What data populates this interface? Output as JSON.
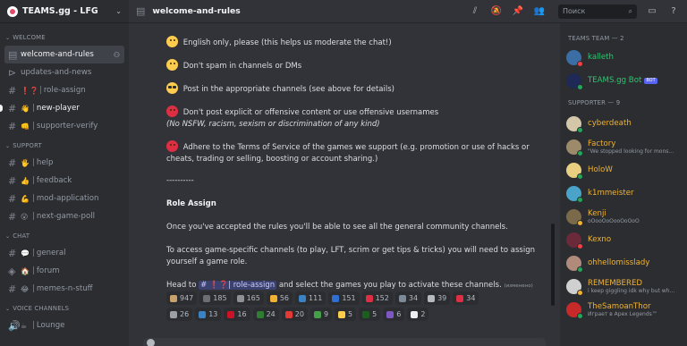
{
  "server": {
    "name": "TEAMS.gg - LFG"
  },
  "sidebar": {
    "cat_welcome": "WELCOME",
    "welcome_channels": [
      {
        "label": "welcome-and-rules"
      },
      {
        "label": "updates-and-news"
      },
      {
        "label": "role-assign",
        "emoji": "❗❓"
      },
      {
        "label": "new-player",
        "emoji": "👋"
      },
      {
        "label": "supporter-verify",
        "emoji": "👊"
      }
    ],
    "cat_support": "SUPPORT",
    "support_channels": [
      {
        "label": "help",
        "emoji": "🖐"
      },
      {
        "label": "feedback",
        "emoji": "👍"
      },
      {
        "label": "mod-application",
        "emoji": "💪"
      },
      {
        "label": "next-game-poll",
        "emoji": "😮"
      }
    ],
    "cat_chat": "CHAT",
    "chat_channels": [
      {
        "label": "general",
        "emoji": "💬"
      },
      {
        "label": "forum",
        "emoji": "🏠"
      },
      {
        "label": "memes-n-stuff"
      }
    ],
    "cat_voice": "VOICE CHANNELS",
    "voice_channels": [
      {
        "label": "Lounge",
        "emoji": "☕"
      }
    ]
  },
  "topbar": {
    "channel": "welcome-and-rules",
    "search_placeholder": "Поиск"
  },
  "messages": {
    "rule1": "English only, please (this helps us moderate the chat!)",
    "rule2": "Don't spam in channels or DMs",
    "rule3": "Post in the appropriate channels (see above for details)",
    "rule4": "Don't post explicit or offensive content or use offensive usernames",
    "rule4_note": "(No NSFW, racism, sexism or discrimination of any kind)",
    "rule5a": "Adhere to the Terms of Service of the games we support (e.g. promotion or use of hacks or",
    "rule5b": "cheats, trading or selling, boosting or account sharing.)",
    "divider": "----------",
    "role_heading": "Role Assign",
    "para1": "Once you've accepted the rules you'll be able to see all the general community channels.",
    "para2a": "To access game-specific channels (to play, LFT, scrim or get tips & tricks) you will need to assign",
    "para2b": "yourself a game role.",
    "head_to": "Head to",
    "mention": "# ❗❓| role-assign",
    "head_to_rest": "and select the games you play to activate these channels.",
    "edited": "(изменено)"
  },
  "reactions": {
    "row1": [
      {
        "count": "947",
        "color": "#c8a26b"
      },
      {
        "count": "185",
        "color": "#6b6e73"
      },
      {
        "count": "165",
        "color": "#8e9297"
      },
      {
        "count": "56",
        "color": "#f0b232"
      },
      {
        "count": "111",
        "color": "#3b82c4"
      },
      {
        "count": "151",
        "color": "#2f6fd1"
      },
      {
        "count": "152",
        "color": "#dd2e44"
      },
      {
        "count": "34",
        "color": "#7c8a9a"
      },
      {
        "count": "39",
        "color": "#b5bac1"
      },
      {
        "count": "34",
        "color": "#dd2e44"
      }
    ],
    "row2": [
      {
        "count": "26",
        "color": "#9aa0a6"
      },
      {
        "count": "13",
        "color": "#3b82c4"
      },
      {
        "count": "16",
        "color": "#ce1126"
      },
      {
        "count": "24",
        "color": "#2e7d32"
      },
      {
        "count": "20",
        "color": "#e53935"
      },
      {
        "count": "9",
        "color": "#43a047"
      },
      {
        "count": "5",
        "color": "#ffcc4d"
      },
      {
        "count": "5",
        "color": "#1b5e20"
      },
      {
        "count": "6",
        "color": "#7e57c2"
      },
      {
        "count": "2",
        "color": "#eceff1"
      }
    ]
  },
  "members": {
    "team_header": "TEAMS TEAM — 2",
    "team": [
      {
        "name": "kalleth",
        "color": "#2dc770",
        "avatar": "#3a6ea5",
        "status": "dnd"
      },
      {
        "name": "TEAMS.gg Bot",
        "color": "#2dc770",
        "avatar": "#1e2a55",
        "status": "online",
        "tag": "BOT"
      }
    ],
    "supporter_header": "SUPPORTER — 9",
    "supporters": [
      {
        "name": "cyberdeath",
        "color": "#f0b232",
        "avatar": "#d4c6a8",
        "status": "online"
      },
      {
        "name": "Factory",
        "color": "#f0b232",
        "avatar": "#9c8a6a",
        "status": "online",
        "sub": "\"We stopped looking for mons..."
      },
      {
        "name": "HoloW",
        "color": "#f0b232",
        "avatar": "#e8d080",
        "status": "online"
      },
      {
        "name": "k1mmeister",
        "color": "#f0b232",
        "avatar": "#4aa3c8",
        "status": "online"
      },
      {
        "name": "Kenji",
        "color": "#f0b232",
        "avatar": "#7a6a4a",
        "status": "idle",
        "sub": "oOooOoOooOoOoO"
      },
      {
        "name": "Kexno",
        "color": "#f0b232",
        "avatar": "#6a2a3a",
        "status": "dnd"
      },
      {
        "name": "ohhellomisslady",
        "color": "#f0b232",
        "avatar": "#b08a7a",
        "status": "online"
      },
      {
        "name": "REMEMBERED",
        "color": "#f0b232",
        "avatar": "#d0d0d0",
        "status": "idle",
        "sub": "i keep giggling idk why but whe..."
      },
      {
        "name": "TheSamoanThor",
        "color": "#f0b232",
        "avatar": "#c82a2a",
        "status": "online",
        "sub": "Играет в Apex Legends™"
      }
    ]
  }
}
